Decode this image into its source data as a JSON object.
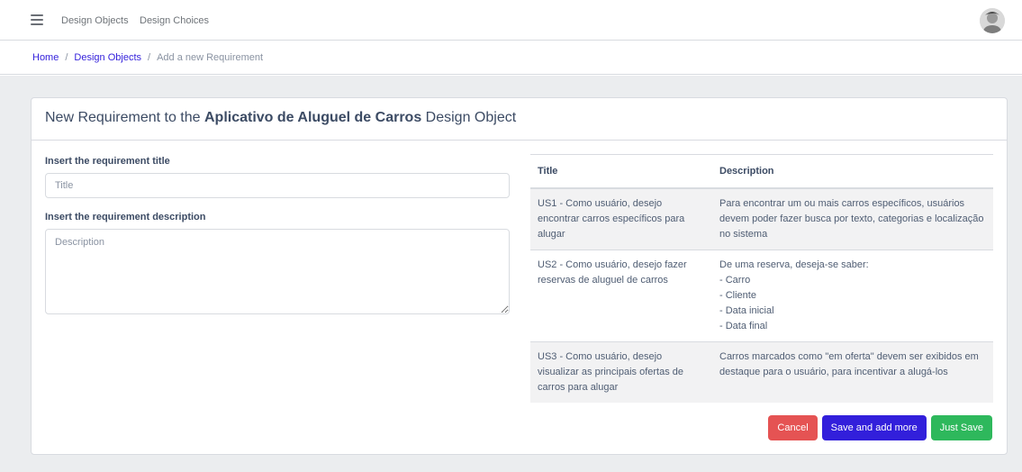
{
  "header": {
    "nav": [
      "Design Objects",
      "Design Choices"
    ]
  },
  "breadcrumb": {
    "home": "Home",
    "design_objects": "Design Objects",
    "current": "Add a new Requirement",
    "separator": "/"
  },
  "card": {
    "title_prefix": "New Requirement to the ",
    "title_object": "Aplicativo de Aluguel de Carros",
    "title_suffix": " Design Object"
  },
  "form": {
    "title_label": "Insert the requirement title",
    "title_placeholder": "Title",
    "description_label": "Insert the requirement description",
    "description_placeholder": "Description"
  },
  "table": {
    "headers": [
      "Title",
      "Description"
    ],
    "rows": [
      {
        "title": "US1 - Como usuário, desejo encontrar carros específicos para alugar",
        "description": [
          "Para encontrar um ou mais carros específicos, usuários devem poder fazer busca por texto, categorias e localização no sistema"
        ]
      },
      {
        "title": "US2 - Como usuário, desejo fazer reservas de aluguel de carros",
        "description": [
          "De uma reserva, deseja-se saber:",
          "- Carro",
          "- Cliente",
          "- Data inicial",
          "- Data final"
        ]
      },
      {
        "title": "US3 - Como usuário, desejo visualizar as principais ofertas de carros para alugar",
        "description": [
          "Carros marcados como \"em oferta\" devem ser exibidos em destaque para o usuário, para incentivar a alugá-los"
        ]
      }
    ]
  },
  "buttons": {
    "cancel": "Cancel",
    "save_more": "Save and add more",
    "just_save": "Just Save"
  },
  "colors": {
    "primary": "#321fdb",
    "danger": "#e55353",
    "success": "#2eb85c",
    "background": "#ebedef"
  }
}
